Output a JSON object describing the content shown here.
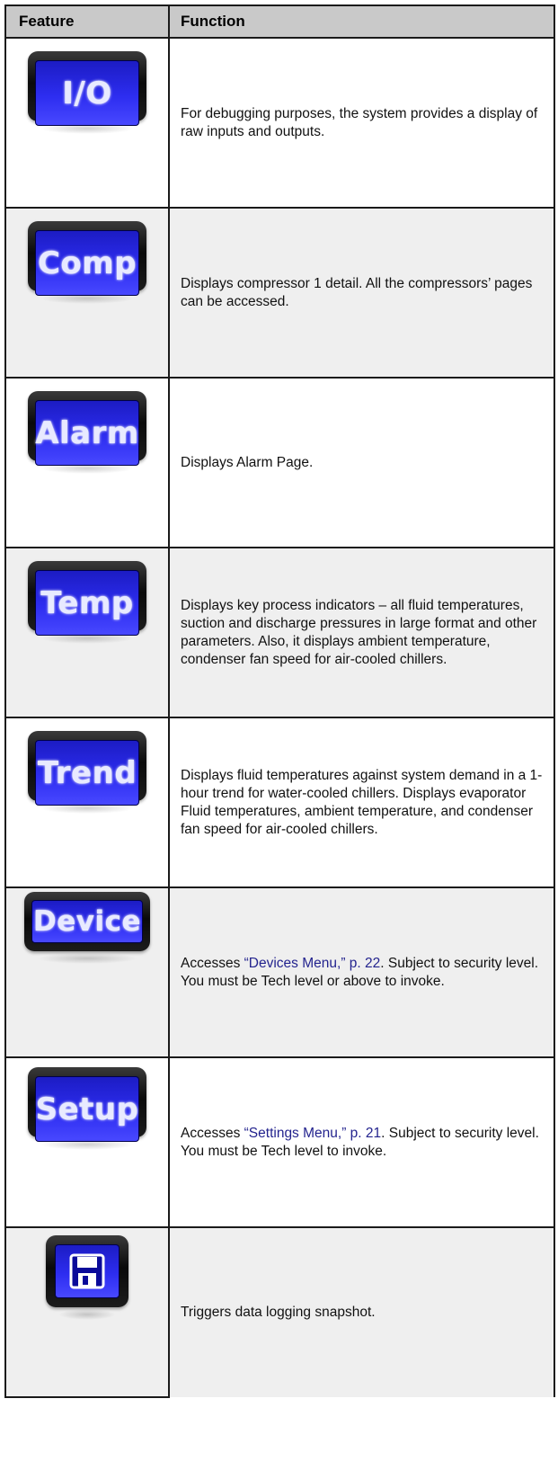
{
  "headers": {
    "feature": "Feature",
    "function": "Function"
  },
  "rows": [
    {
      "button_label": "I/O",
      "description": "For debugging purposes, the system provides a display of raw inputs and outputs."
    },
    {
      "button_label": "Comp",
      "description": "Displays compressor 1 detail. All the compressors’ pages can be accessed."
    },
    {
      "button_label": "Alarm",
      "description": "Displays Alarm Page."
    },
    {
      "button_label": "Temp",
      "description": "Displays key process indicators – all fluid temperatures, suction and discharge pressures in large format and other parameters. Also, it displays ambient temperature, condenser fan speed for air-cooled chillers."
    },
    {
      "button_label": "Trend",
      "description": "Displays fluid temperatures against system demand in a 1-hour trend for water-cooled chillers. Displays evaporator Fluid temperatures, ambient temperature, and condenser fan speed for air-cooled chillers."
    },
    {
      "button_label": "Device",
      "description_pre": "Accesses ",
      "description_link": "“Devices Menu,” p. 22",
      "description_post": ". Subject to security level. You must be Tech level or above to invoke."
    },
    {
      "button_label": "Setup",
      "description_pre": "Accesses ",
      "description_link": "“Settings Menu,” p. 21",
      "description_post": ". Subject to security level. You must be Tech level to invoke."
    },
    {
      "button_icon": "floppy-disk-icon",
      "description": "Triggers data logging snapshot."
    }
  ],
  "colors": {
    "link": "#23238e",
    "button_face": "#2d2df0",
    "header_bg": "#c9c9c9",
    "alt_row_bg": "#efefef"
  }
}
